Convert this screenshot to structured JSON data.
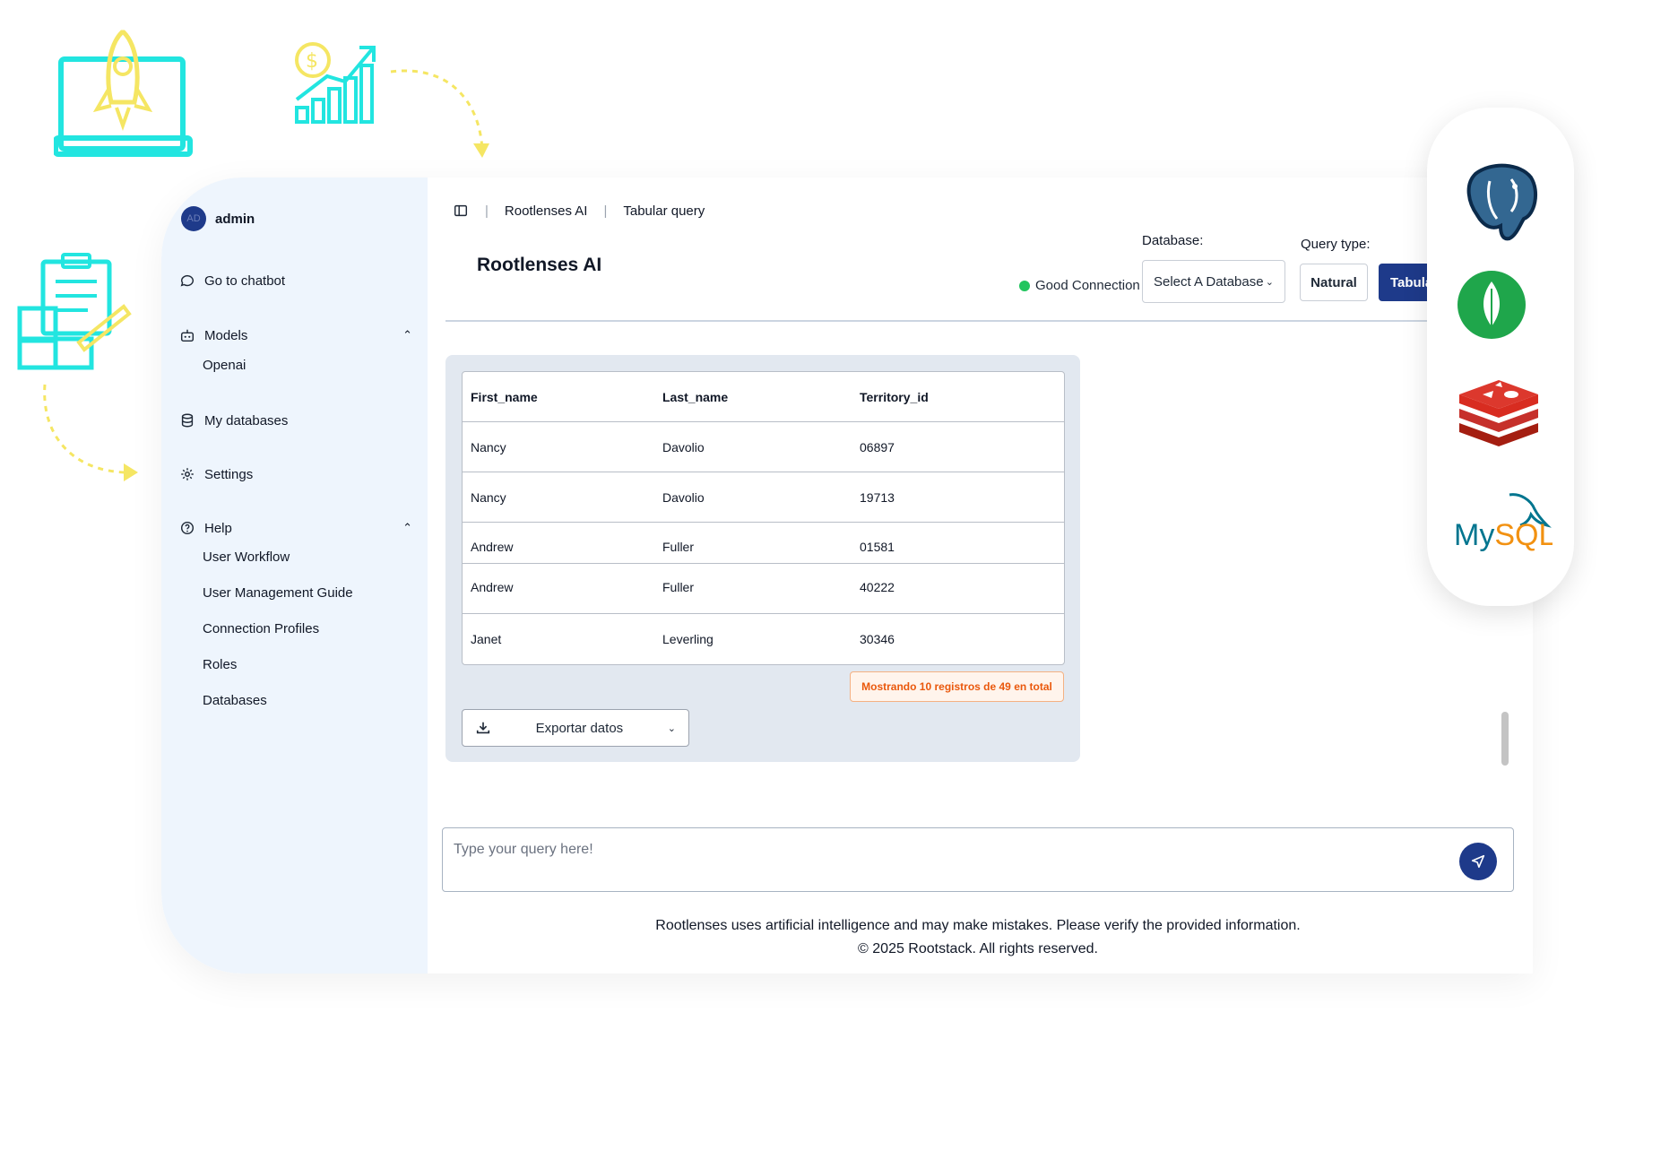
{
  "user": {
    "initials": "AD",
    "name": "admin"
  },
  "sidebar": {
    "chatbot": "Go to chatbot",
    "models": {
      "label": "Models",
      "items": [
        "Openai"
      ]
    },
    "my_databases": "My databases",
    "settings": "Settings",
    "help": {
      "label": "Help",
      "items": [
        "User Workflow",
        "User Management Guide",
        "Connection Profiles",
        "Roles",
        "Databases"
      ]
    }
  },
  "breadcrumb": [
    "Rootlenses AI",
    "Tabular query"
  ],
  "page_title": "Rootlenses AI",
  "connection": {
    "status": "Good Connection",
    "color": "#22c55e"
  },
  "database": {
    "label": "Database:",
    "selected": "Select A Database"
  },
  "query_type": {
    "label": "Query type:",
    "options": [
      "Natural",
      "Tabular"
    ],
    "active": "Tabular"
  },
  "table": {
    "headers": [
      "First_name",
      "Last_name",
      "Territory_id"
    ],
    "rows": [
      [
        "Nancy",
        "Davolio",
        "06897"
      ],
      [
        "Nancy",
        "Davolio",
        "19713"
      ],
      [
        "Andrew",
        "Fuller",
        "01581"
      ],
      [
        "Andrew",
        "Fuller",
        "40222"
      ],
      [
        "Janet",
        "Leverling",
        "30346"
      ]
    ]
  },
  "records_badge": "Mostrando 10 registros de 49 en total",
  "export_label": "Exportar datos",
  "query_input": {
    "placeholder": "Type your query here!",
    "value": ""
  },
  "footer": {
    "disclaimer": "Rootlenses uses artificial intelligence and may make mistakes. Please verify the provided information.",
    "copyright": "© 2025 Rootstack. All rights reserved."
  },
  "logos": [
    "postgresql-logo",
    "mongodb-logo",
    "redis-logo",
    "mysql-logo"
  ],
  "mysql_text": "MySQL",
  "colors": {
    "primary": "#1e3a8a",
    "accent_cyan": "#22e5e0",
    "accent_yellow": "#f5e663",
    "sidebar_bg": "#eef5fd"
  }
}
